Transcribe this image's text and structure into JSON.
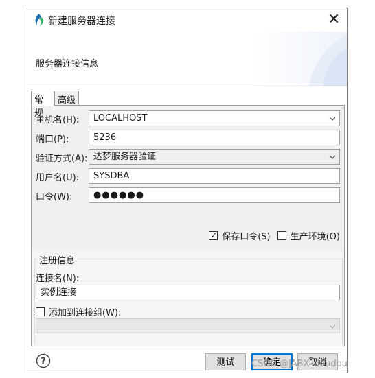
{
  "window": {
    "title": "新建服务器连接",
    "close_glyph": "✕"
  },
  "banner": {
    "title": "服务器连接信息"
  },
  "tabs": [
    {
      "label": "常规",
      "active": true
    },
    {
      "label": "高级",
      "active": false
    }
  ],
  "form": {
    "host": {
      "label": "主机名(H):",
      "value": "LOCALHOST"
    },
    "port": {
      "label": "端口(P):",
      "value": "5236"
    },
    "auth": {
      "label": "验证方式(A):",
      "value": "达梦服务器验证"
    },
    "username": {
      "label": "用户名(U):",
      "value": "SYSDBA"
    },
    "password": {
      "label": "口令(W):",
      "value": "●●●●●●"
    },
    "save_password": {
      "label": "保存口令(S)",
      "checked": true
    },
    "production_env": {
      "label": "生产环境(O)",
      "checked": false
    }
  },
  "registration": {
    "group_title": "注册信息",
    "conn_name_label": "连接名(N):",
    "conn_name_value": "实例连接",
    "add_to_group_label": "添加到连接组(W):",
    "add_to_group_checked": false
  },
  "footer": {
    "help_icon": "help-icon",
    "test_label": "测试",
    "ok_label": "确定",
    "cancel_label": "取消"
  },
  "watermark": "CSDN @JABX_doudou",
  "colors": {
    "accent": "#0078d7",
    "button_bg": "#e1e1e1",
    "panel_bg": "#f0f0f0"
  }
}
